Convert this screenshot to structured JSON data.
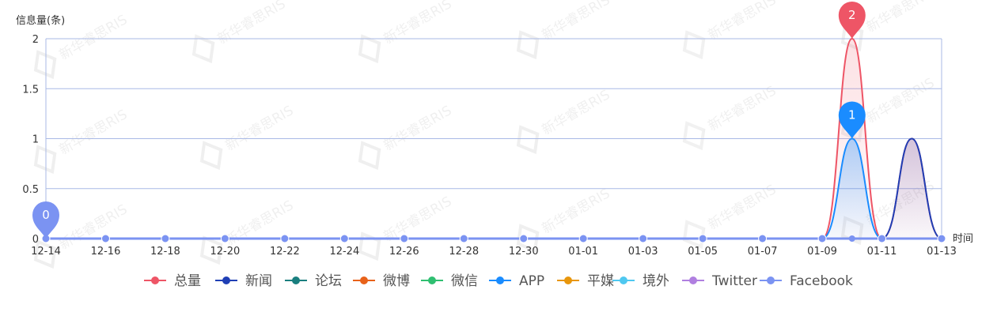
{
  "chart_data": {
    "type": "area",
    "y_axis_title": "信息量(条)",
    "x_axis_title": "时间",
    "ylim": [
      0,
      2
    ],
    "y_ticks": [
      "0",
      "0.5",
      "1",
      "1.5",
      "2"
    ],
    "x_tick_labels": [
      "12-14",
      "12-16",
      "12-18",
      "12-20",
      "12-22",
      "12-24",
      "12-26",
      "12-28",
      "12-30",
      "01-01",
      "01-03",
      "01-05",
      "01-07",
      "01-09",
      "01-11",
      "01-13"
    ],
    "categories": [
      "12-14",
      "12-15",
      "12-16",
      "12-17",
      "12-18",
      "12-19",
      "12-20",
      "12-21",
      "12-22",
      "12-23",
      "12-24",
      "12-25",
      "12-26",
      "12-27",
      "12-28",
      "12-29",
      "12-30",
      "12-31",
      "01-01",
      "01-02",
      "01-03",
      "01-04",
      "01-05",
      "01-06",
      "01-07",
      "01-08",
      "01-09",
      "01-10",
      "01-11",
      "01-12",
      "01-13"
    ],
    "grid": true,
    "legend_position": "bottom",
    "series": [
      {
        "name": "总量",
        "color": "#ee5566",
        "values": [
          0,
          0,
          0,
          0,
          0,
          0,
          0,
          0,
          0,
          0,
          0,
          0,
          0,
          0,
          0,
          0,
          0,
          0,
          0,
          0,
          0,
          0,
          0,
          0,
          0,
          0,
          0,
          2,
          0,
          1,
          0
        ]
      },
      {
        "name": "新闻",
        "color": "#1f3fb5",
        "values": [
          0,
          0,
          0,
          0,
          0,
          0,
          0,
          0,
          0,
          0,
          0,
          0,
          0,
          0,
          0,
          0,
          0,
          0,
          0,
          0,
          0,
          0,
          0,
          0,
          0,
          0,
          0,
          0,
          0,
          1,
          0
        ]
      },
      {
        "name": "论坛",
        "color": "#1a7f7f",
        "values": [
          0,
          0,
          0,
          0,
          0,
          0,
          0,
          0,
          0,
          0,
          0,
          0,
          0,
          0,
          0,
          0,
          0,
          0,
          0,
          0,
          0,
          0,
          0,
          0,
          0,
          0,
          0,
          0,
          0,
          0,
          0
        ]
      },
      {
        "name": "微博",
        "color": "#e8621a",
        "values": [
          0,
          0,
          0,
          0,
          0,
          0,
          0,
          0,
          0,
          0,
          0,
          0,
          0,
          0,
          0,
          0,
          0,
          0,
          0,
          0,
          0,
          0,
          0,
          0,
          0,
          0,
          0,
          0,
          0,
          0,
          0
        ]
      },
      {
        "name": "微信",
        "color": "#2fbf71",
        "values": [
          0,
          0,
          0,
          0,
          0,
          0,
          0,
          0,
          0,
          0,
          0,
          0,
          0,
          0,
          0,
          0,
          0,
          0,
          0,
          0,
          0,
          0,
          0,
          0,
          0,
          0,
          0,
          0,
          0,
          0,
          0
        ]
      },
      {
        "name": "APP",
        "color": "#1a8cff",
        "values": [
          0,
          0,
          0,
          0,
          0,
          0,
          0,
          0,
          0,
          0,
          0,
          0,
          0,
          0,
          0,
          0,
          0,
          0,
          0,
          0,
          0,
          0,
          0,
          0,
          0,
          0,
          0,
          1,
          0,
          0,
          0
        ]
      },
      {
        "name": "平媒",
        "color": "#e8960c",
        "values": [
          0,
          0,
          0,
          0,
          0,
          0,
          0,
          0,
          0,
          0,
          0,
          0,
          0,
          0,
          0,
          0,
          0,
          0,
          0,
          0,
          0,
          0,
          0,
          0,
          0,
          0,
          0,
          0,
          0,
          0,
          0
        ]
      },
      {
        "name": "境外",
        "color": "#4fc8f0",
        "values": [
          0,
          0,
          0,
          0,
          0,
          0,
          0,
          0,
          0,
          0,
          0,
          0,
          0,
          0,
          0,
          0,
          0,
          0,
          0,
          0,
          0,
          0,
          0,
          0,
          0,
          0,
          0,
          0,
          0,
          0,
          0
        ]
      },
      {
        "name": "Twitter",
        "color": "#b07fe0",
        "values": [
          0,
          0,
          0,
          0,
          0,
          0,
          0,
          0,
          0,
          0,
          0,
          0,
          0,
          0,
          0,
          0,
          0,
          0,
          0,
          0,
          0,
          0,
          0,
          0,
          0,
          0,
          0,
          0,
          0,
          0,
          0
        ]
      },
      {
        "name": "Facebook",
        "color": "#7b93f2",
        "values": [
          0,
          0,
          0,
          0,
          0,
          0,
          0,
          0,
          0,
          0,
          0,
          0,
          0,
          0,
          0,
          0,
          0,
          0,
          0,
          0,
          0,
          0,
          0,
          0,
          0,
          0,
          0,
          0,
          0,
          0,
          0
        ]
      }
    ],
    "markers": [
      {
        "label": "2",
        "category": "01-10",
        "value": 2,
        "color": "#ee5566"
      },
      {
        "label": "1",
        "category": "01-10",
        "value": 1,
        "color": "#1a8cff"
      },
      {
        "label": "0",
        "category": "12-14",
        "value": 0,
        "color": "#7b93f2"
      }
    ],
    "watermark": "新华睿思RIS"
  }
}
